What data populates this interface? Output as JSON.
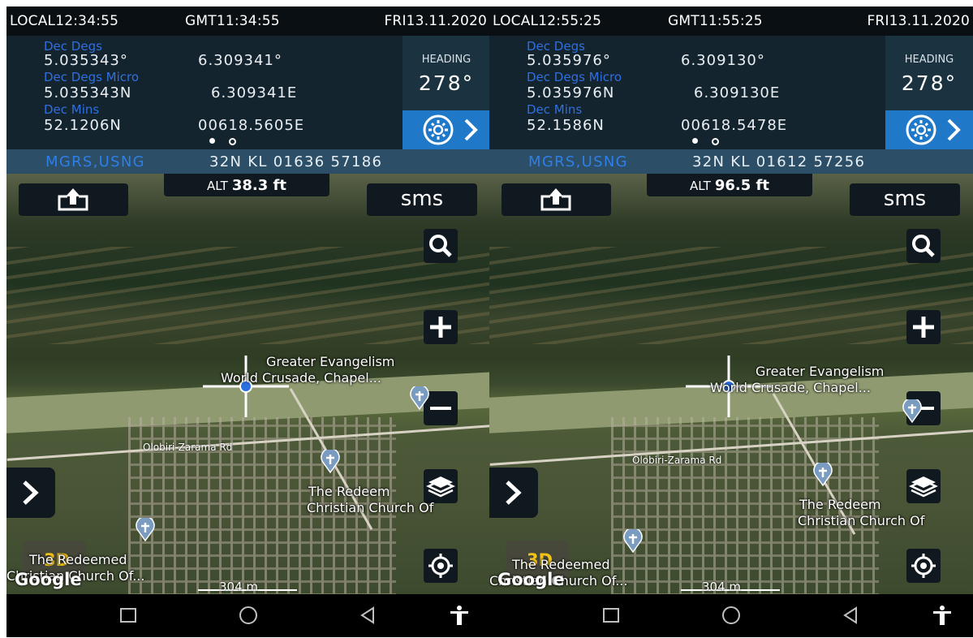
{
  "panels": [
    {
      "status": {
        "local": "LOCAL12:34:55",
        "gmt": "GMT11:34:55",
        "date": "FRI13.11.2020"
      },
      "coords": {
        "dec_degs_label": "Dec Degs",
        "dec_degs_lat": "5.035343°",
        "dec_degs_lon": "6.309341°",
        "dec_degs_micro_label": "Dec Degs Micro",
        "micro_lat": "5.035343N",
        "micro_lon": "6.309341E",
        "dec_mins_label": "Dec Mins",
        "mins_lat": "52.1206N",
        "mins_lon": "00618.5605E"
      },
      "heading": {
        "label": "HEADING",
        "value": "278°"
      },
      "mgrs": {
        "label": "MGRS,USNG",
        "value": "32N KL 01636 57186"
      },
      "alt": {
        "label": "ALT",
        "value": "38.3 ft"
      },
      "sms_label": "sms",
      "btn_3d": "3D",
      "scale": "304 m",
      "google": "Google",
      "labels": {
        "church1_line1": "Greater Evangelism",
        "church1_line2": "World Crusade, Chapel...",
        "road": "Olobiri-Zarama Rd",
        "church2_line1": "The Redeem",
        "church2_line2": "Christian Church Of",
        "church3_line1": "The Redeemed",
        "church3_line2": "Christian Church Of..."
      }
    },
    {
      "status": {
        "local": "LOCAL12:55:25",
        "gmt": "GMT11:55:25",
        "date": "FRI13.11.2020"
      },
      "coords": {
        "dec_degs_label": "Dec Degs",
        "dec_degs_lat": "5.035976°",
        "dec_degs_lon": "6.309130°",
        "dec_degs_micro_label": "Dec Degs Micro",
        "micro_lat": "5.035976N",
        "micro_lon": "6.309130E",
        "dec_mins_label": "Dec Mins",
        "mins_lat": "52.1586N",
        "mins_lon": "00618.5478E"
      },
      "heading": {
        "label": "HEADING",
        "value": "278°"
      },
      "mgrs": {
        "label": "MGRS,USNG",
        "value": "32N KL 01612 57256"
      },
      "alt": {
        "label": "ALT",
        "value": "96.5 ft"
      },
      "sms_label": "sms",
      "btn_3d": "3D",
      "scale": "304 m",
      "google": "Google",
      "labels": {
        "church1_line1": "Greater Evangelism",
        "church1_line2": "World Crusade, Chapel...",
        "road": "Olobiri-Zarama Rd",
        "church2_line1": "The Redeem",
        "church2_line2": "Christian Church Of",
        "church3_line1": "The Redeemed",
        "church3_line2": "Christian Church Of..."
      }
    }
  ],
  "icons": {
    "share": "share-icon",
    "settings": "gear-icon",
    "next": "chevron-right-icon",
    "search": "search-icon",
    "zoom_in": "plus-icon",
    "zoom_out": "minus-icon",
    "layers": "layers-icon",
    "locate": "crosshair-location-icon",
    "expand": "chevron-right-icon",
    "church": "church-pin-icon",
    "nav_recent": "square-icon",
    "nav_home": "circle-icon",
    "nav_back": "triangle-back-icon",
    "nav_accessibility": "accessibility-icon"
  },
  "colors": {
    "accent_blue": "#1f78c8",
    "label_blue": "#2f6fe0",
    "three_d_yellow": "#f2c318"
  }
}
